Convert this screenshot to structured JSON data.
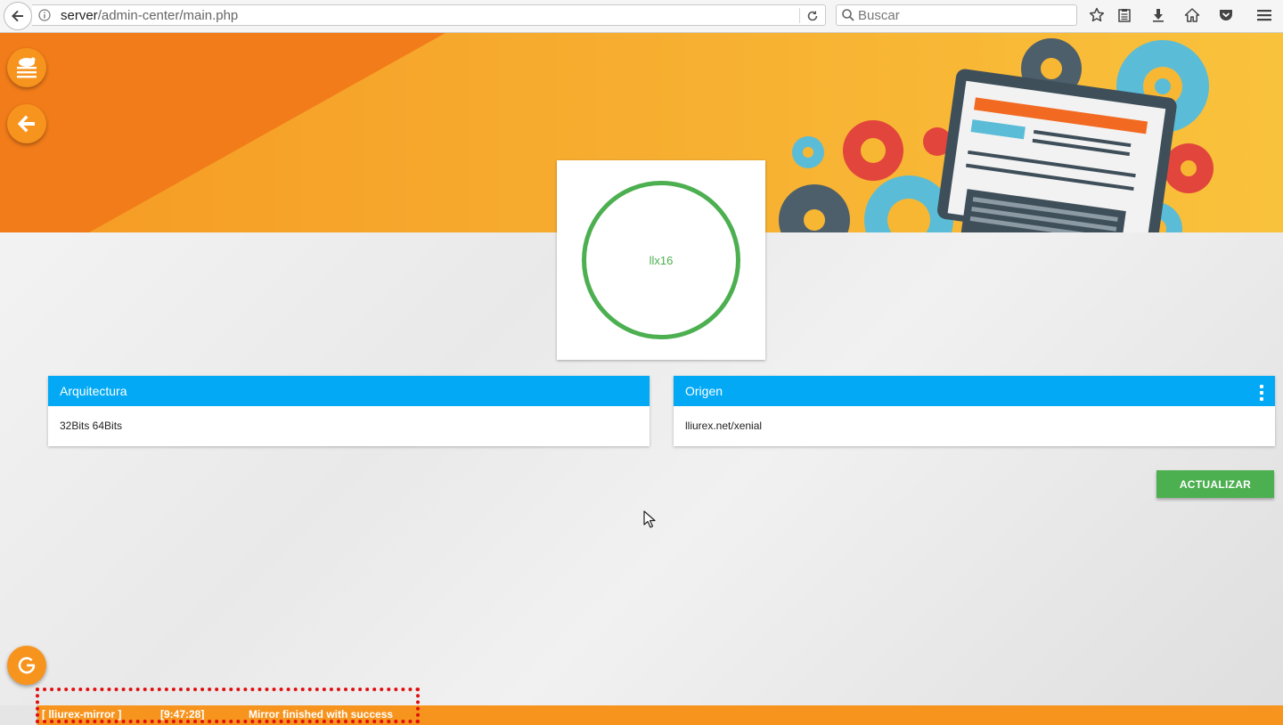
{
  "browser": {
    "url_host": "server",
    "url_path": "/admin-center/main.php",
    "search_placeholder": "Buscar"
  },
  "server": {
    "name": "llx16"
  },
  "cards": {
    "arch": {
      "title": "Arquitectura",
      "value": "32Bits 64Bits"
    },
    "origin": {
      "title": "Origen",
      "value": "lliurex.net/xenial"
    }
  },
  "actions": {
    "update_label": "ACTUALIZAR"
  },
  "status": {
    "source": "[ lliurex-mirror ]",
    "time": "[9:47:28]",
    "message": "Mirror finished with success"
  },
  "colors": {
    "accent_orange": "#f7941d",
    "header_blue": "#03a9f4",
    "success_green": "#4caf50"
  },
  "icons": {
    "fab_top": "menu-mascot-icon",
    "fab_back": "arrow-left-icon",
    "fab_bottom": "refresh-icon"
  }
}
